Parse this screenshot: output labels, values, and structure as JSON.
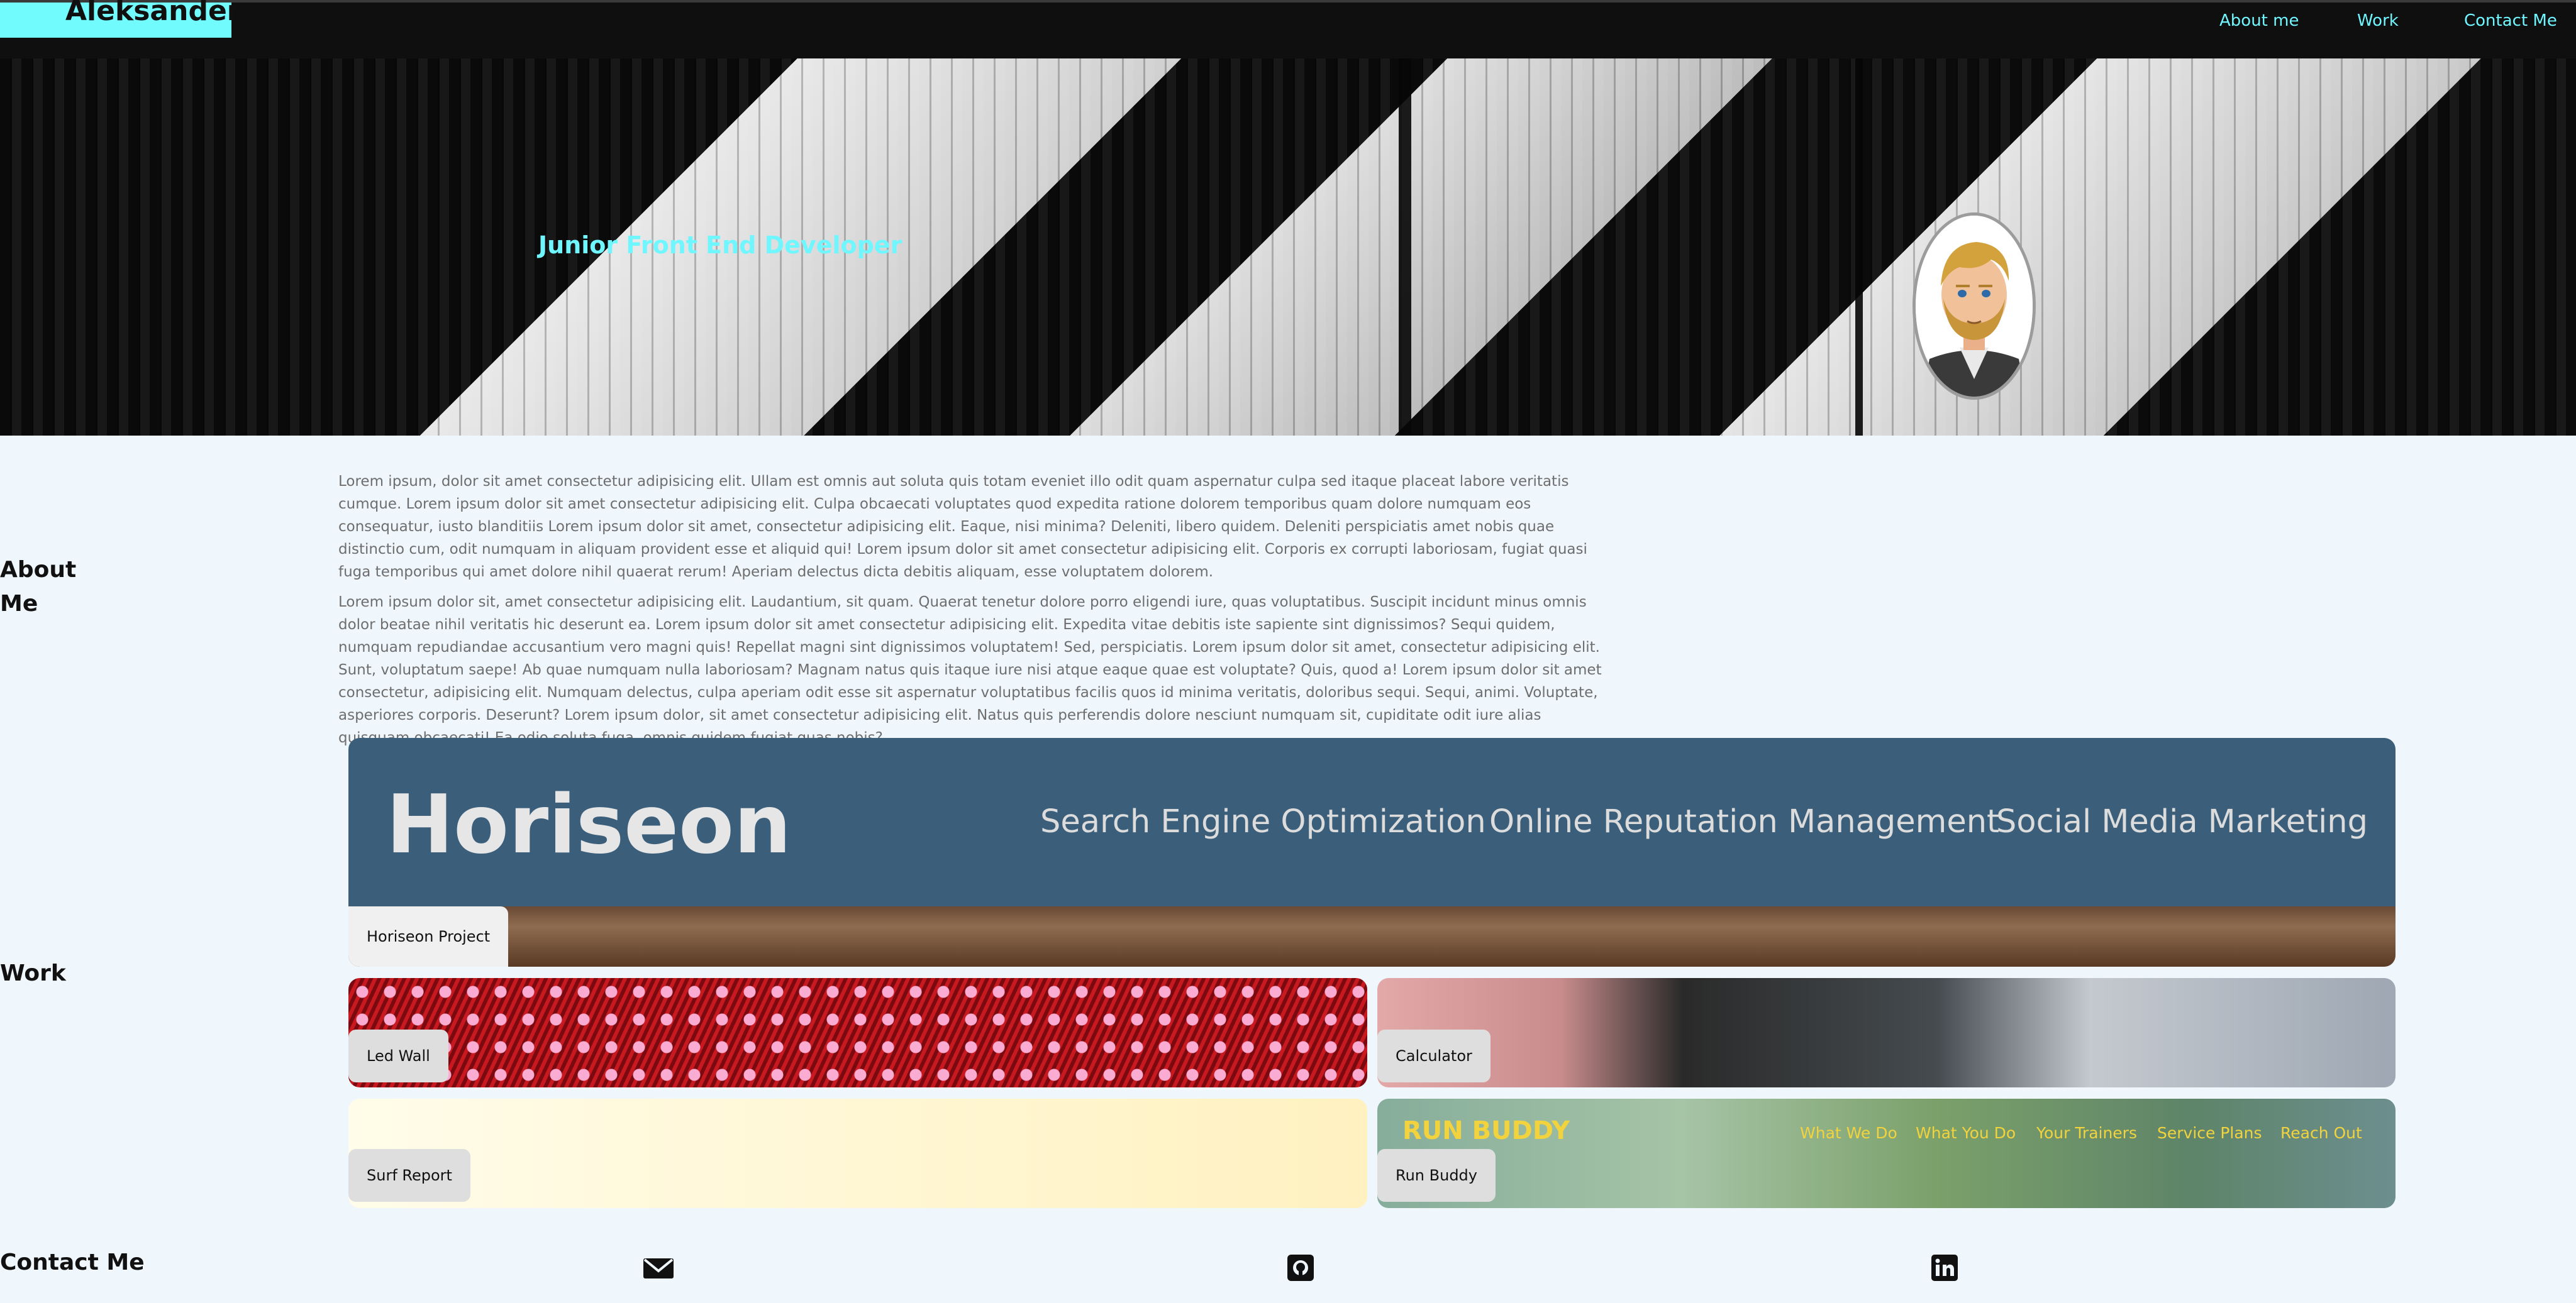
{
  "header": {
    "brand": "Aleksander",
    "nav": [
      "About me",
      "Work",
      "Contact Me"
    ]
  },
  "hero": {
    "title": "Junior Front End Developer",
    "avatar_icon": "avatar-icon"
  },
  "about": {
    "heading_line1": "About",
    "heading_line2": "Me",
    "paragraphs": [
      "Lorem ipsum, dolor sit amet consectetur adipisicing elit. Ullam est omnis aut soluta quis totam eveniet illo odit quam aspernatur culpa sed itaque placeat labore veritatis cumque. Lorem ipsum dolor sit amet consectetur adipisicing elit. Culpa obcaecati voluptates quod expedita ratione dolorem temporibus quam dolore numquam eos consequatur, iusto blanditiis Lorem ipsum dolor sit amet, consectetur adipisicing elit. Eaque, nisi minima? Deleniti, libero quidem. Deleniti perspiciatis amet nobis quae distinctio cum, odit numquam in aliquam provident esse et aliquid qui! Lorem ipsum dolor sit amet consectetur adipisicing elit. Corporis ex corrupti laboriosam, fugiat quasi fuga temporibus qui amet dolore nihil quaerat rerum! Aperiam delectus dicta debitis aliquam, esse voluptatem dolorem.",
      "Lorem ipsum dolor sit, amet consectetur adipisicing elit. Laudantium, sit quam. Quaerat tenetur dolore porro eligendi iure, quas voluptatibus. Suscipit incidunt minus omnis dolor beatae nihil veritatis hic deserunt ea. Lorem ipsum dolor sit amet consectetur adipisicing elit. Expedita vitae debitis iste sapiente sint dignissimos? Sequi quidem, numquam repudiandae accusantium vero magni quis! Repellat magni sint dignissimos voluptatem! Sed, perspiciatis. Lorem ipsum dolor sit amet, consectetur adipisicing elit. Sunt, voluptatum saepe! Ab quae numquam nulla laboriosam? Magnam natus quis itaque iure nisi atque eaque quae est voluptate? Quis, quod a! Lorem ipsum dolor sit amet consectetur, adipisicing elit. Numquam delectus, culpa aperiam odit esse sit aspernatur voluptatibus facilis quos id minima veritatis, doloribus sequi. Sequi, animi. Voluptate, asperiores corporis. Deserunt? Lorem ipsum dolor, sit amet consectetur adipisicing elit. Natus quis perferendis dolore nesciunt numquam sit, cupiditate odit iure alias quisquam obcaecati! Ea odio soluta fuga, omnis quidem fugiat quas nobis?"
    ]
  },
  "work": {
    "heading": "Work",
    "horiseon": {
      "label": "Horiseon Project",
      "logo": "Horiseon",
      "menu": [
        "Search Engine Optimization",
        "Online Reputation Management",
        "Social Media Marketing"
      ]
    },
    "projects": [
      {
        "label": "Led Wall"
      },
      {
        "label": "Calculator"
      },
      {
        "label": "Surf Report"
      },
      {
        "label": "Run Buddy"
      }
    ],
    "runbuddy": {
      "logo": "RUN BUDDY",
      "menu": [
        "What We Do",
        "What You Do",
        "Your Trainers",
        "Service Plans",
        "Reach Out"
      ]
    }
  },
  "contact": {
    "heading": "Contact Me",
    "icons": [
      "email-icon",
      "github-icon",
      "linkedin-icon"
    ]
  },
  "colors": {
    "accent": "#71fbfd",
    "header_bg": "#0f0f0f",
    "page_bg": "#eff6fc"
  }
}
